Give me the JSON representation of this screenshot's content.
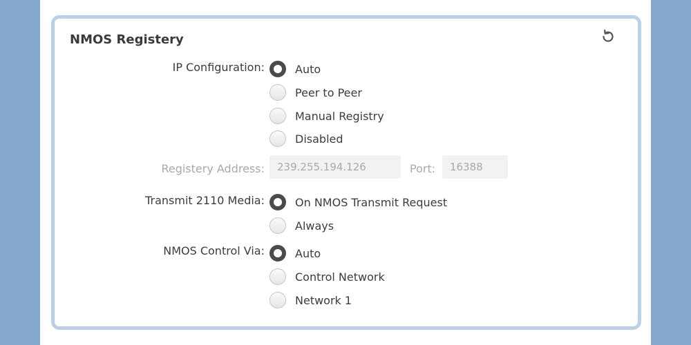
{
  "panel": {
    "title": "NMOS Registery",
    "reset_icon": "rotate-ccw-icon"
  },
  "ip_configuration": {
    "label": "IP Configuration:",
    "selected": "Auto",
    "options": [
      "Auto",
      "Peer to Peer",
      "Manual Registry",
      "Disabled"
    ]
  },
  "registry": {
    "address_label": "Registery Address:",
    "address_value": "239.255.194.126",
    "port_label": "Port:",
    "port_value": "16388"
  },
  "transmit_media": {
    "label": "Transmit 2110 Media:",
    "selected": "On NMOS Transmit Request",
    "options": [
      "On NMOS Transmit Request",
      "Always"
    ]
  },
  "control_via": {
    "label": "NMOS Control Via:",
    "selected": "Auto",
    "options": [
      "Auto",
      "Control Network",
      "Network 1"
    ]
  },
  "colors": {
    "background": "#86aacf",
    "panel_border": "#b9d0e6",
    "radio_checked": "#4b4b4b"
  }
}
